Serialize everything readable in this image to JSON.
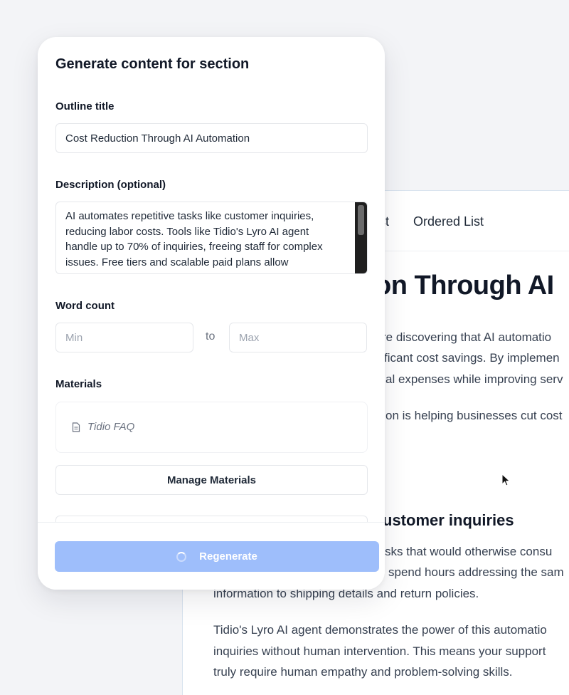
{
  "modal": {
    "title": "Generate content for section",
    "outline_label": "Outline title",
    "outline_value": "Cost Reduction Through AI Automation",
    "description_label": "Description (optional)",
    "description_lines": [
      "AI automates repetitive tasks like customer inquiries,",
      "reducing labor costs. Tools like Tidio's Lyro AI agent",
      "handle up to 70% of inquiries, freeing staff for complex",
      "issues. Free tiers and scalable paid plans allow"
    ],
    "word_count_label": "Word count",
    "min_placeholder": "Min",
    "to_label": "to",
    "max_placeholder": "Max",
    "materials_label": "Materials",
    "materials": [
      {
        "name": "Tidio FAQ",
        "icon": "document-icon"
      }
    ],
    "manage_button": "Manage Materials",
    "regenerate_button": "Regenerate"
  },
  "document": {
    "toolbar": {
      "unordered_partial": "List",
      "ordered": "Ordered List"
    },
    "title_partial": "on Through AI",
    "paragraph1": [
      "re discovering that AI automatio",
      "ficant cost savings. By implemen",
      "al expenses while improving serv"
    ],
    "paragraph2": "on is helping businesses cut cost",
    "heading2_partial": "ustomer inquiries",
    "paragraph3": [
      "sks that would otherwise consu",
      "spend hours addressing the sam",
      "information to shipping details and return policies."
    ],
    "paragraph4": [
      "Tidio's Lyro AI agent demonstrates the power of this automatio",
      "inquiries without human intervention. This means your support",
      "truly require human empathy and problem-solving skills."
    ]
  },
  "colors": {
    "primary_button": "#9ebefb",
    "background": "#f3f4f7",
    "text": "#111827",
    "muted": "#6b7280"
  }
}
